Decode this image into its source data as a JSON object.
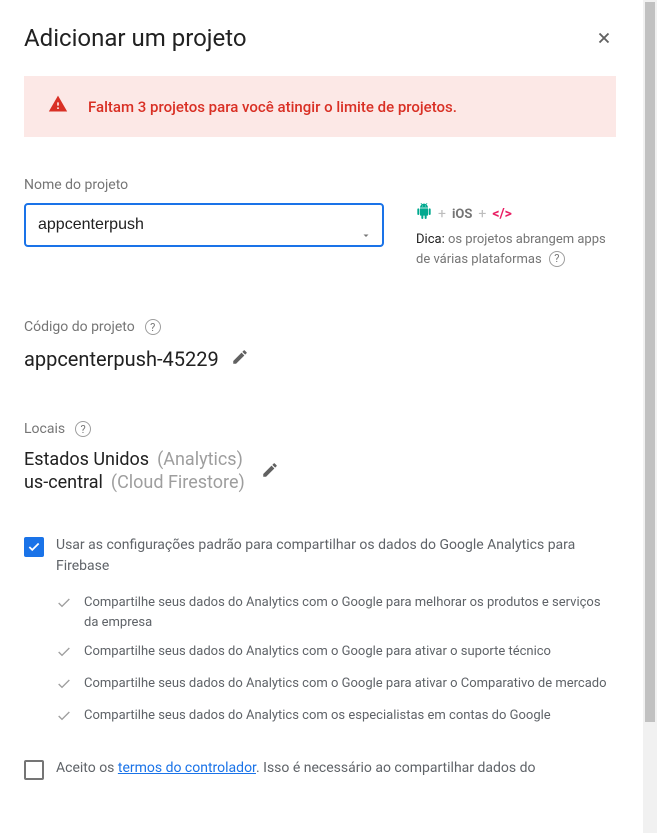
{
  "dialog": {
    "title": "Adicionar um projeto"
  },
  "warning": {
    "text": "Faltam 3 projetos para você atingir o limite de projetos."
  },
  "project_name": {
    "label": "Nome do projeto",
    "value": "appcenterpush"
  },
  "tip": {
    "label": "Dica:",
    "text": "os projetos abrangem apps de várias plataformas",
    "ios_text": "iOS",
    "web_text": "</>"
  },
  "project_id": {
    "label": "Código do projeto",
    "value": "appcenterpush-45229"
  },
  "locations": {
    "label": "Locais",
    "items": [
      {
        "name": "Estados Unidos",
        "service": "(Analytics)"
      },
      {
        "name": "us-central",
        "service": "(Cloud Firestore)"
      }
    ]
  },
  "analytics_checkbox": {
    "label": "Usar as configurações padrão para compartilhar os dados do Google Analytics para Firebase",
    "sub_items": [
      "Compartilhe seus dados do Analytics com o Google para melhorar os produtos e serviços da empresa",
      "Compartilhe seus dados do Analytics com o Google para ativar o suporte técnico",
      "Compartilhe seus dados do Analytics com o Google para ativar o Comparativo de mercado",
      "Compartilhe seus dados do Analytics com os especialistas em contas do Google"
    ]
  },
  "terms": {
    "prefix": "Aceito os ",
    "link": "termos do controlador",
    "suffix": ". Isso é necessário ao compartilhar dados do"
  }
}
